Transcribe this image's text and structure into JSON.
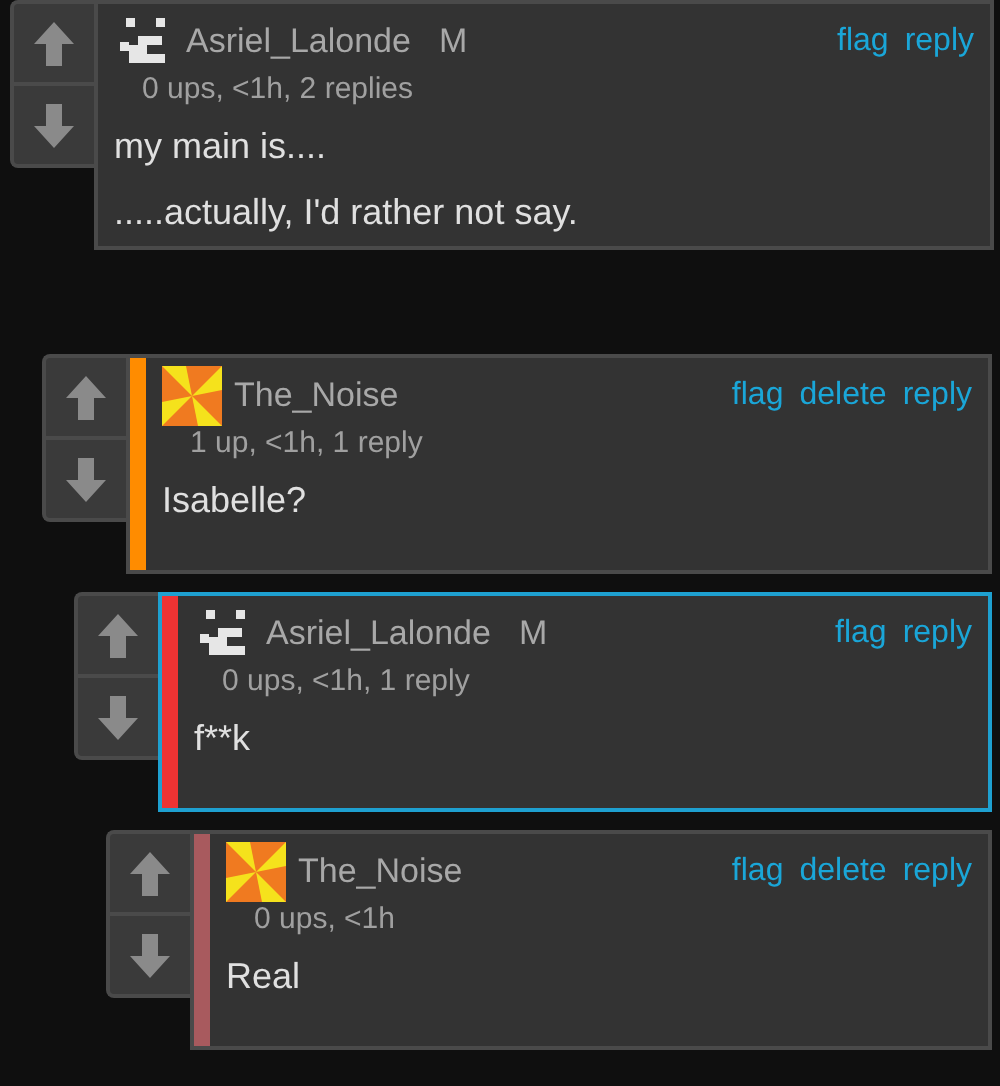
{
  "comments": [
    {
      "avatar": {
        "kind": "pixel"
      },
      "username": "Asriel_Lalonde",
      "badge": "M",
      "meta": "0 ups, <1h, 2 replies",
      "body": [
        "my main is....",
        ".....actually, I'd rather not say."
      ],
      "actions": [
        "flag",
        "reply"
      ],
      "highlighted": false,
      "children": [
        {
          "avatar": {
            "kind": "pinwheel"
          },
          "username": "The_Noise",
          "meta": "1 up, <1h, 1 reply",
          "body": [
            "Isabelle?"
          ],
          "actions": [
            "flag",
            "delete",
            "reply"
          ],
          "color": "#ff8c00",
          "highlighted": false,
          "children": [
            {
              "avatar": {
                "kind": "pixel"
              },
              "username": "Asriel_Lalonde",
              "badge": "M",
              "meta": "0 ups, <1h, 1 reply",
              "body": [
                "f**k"
              ],
              "actions": [
                "flag",
                "reply"
              ],
              "color": "#ee3333",
              "highlighted": true,
              "children": [
                {
                  "avatar": {
                    "kind": "pinwheel"
                  },
                  "username": "The_Noise",
                  "meta": "0 ups, <1h",
                  "body": [
                    "Real"
                  ],
                  "actions": [
                    "flag",
                    "delete",
                    "reply"
                  ],
                  "color": "#a85a5e",
                  "highlighted": false
                }
              ]
            }
          ]
        }
      ]
    }
  ]
}
